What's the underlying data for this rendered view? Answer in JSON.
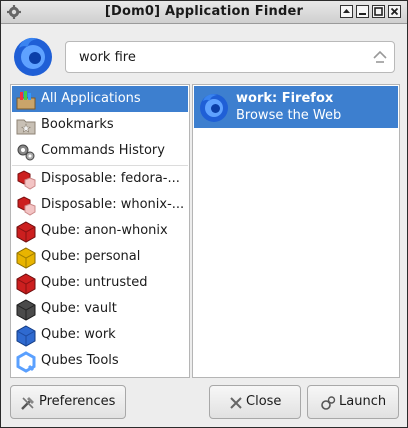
{
  "window": {
    "title": "[Dom0] Application Finder"
  },
  "search": {
    "value": "work fire"
  },
  "categories": [
    {
      "label": "All Applications",
      "icon": "all-applications-icon",
      "selected": true
    },
    {
      "label": "Bookmarks",
      "icon": "bookmarks-folder-icon"
    },
    {
      "label": "Commands History",
      "icon": "gears-icon"
    },
    {
      "label": "Disposable: fedora-...",
      "icon": "qube-red-small-icon"
    },
    {
      "label": "Disposable: whonix-...",
      "icon": "qube-red-small-icon"
    },
    {
      "label": "Qube: anon-whonix",
      "icon": "qube-red-icon"
    },
    {
      "label": "Qube: personal",
      "icon": "qube-yellow-icon"
    },
    {
      "label": "Qube: untrusted",
      "icon": "qube-red-icon"
    },
    {
      "label": "Qube: vault",
      "icon": "qube-black-icon"
    },
    {
      "label": "Qube: work",
      "icon": "qube-blue-icon"
    },
    {
      "label": "Qubes Tools",
      "icon": "qubes-logo-icon"
    }
  ],
  "results": [
    {
      "name": "work: Firefox",
      "description": "Browse the Web",
      "icon": "firefox-icon"
    }
  ],
  "buttons": {
    "preferences": "Preferences",
    "close": "Close",
    "launch": "Launch"
  },
  "colors": {
    "selection": "#3d7fcf",
    "qube_red": "#cc1f1f",
    "qube_yellow": "#e8b400",
    "qube_black": "#4a4a4a",
    "qube_blue": "#2f6ad0"
  }
}
